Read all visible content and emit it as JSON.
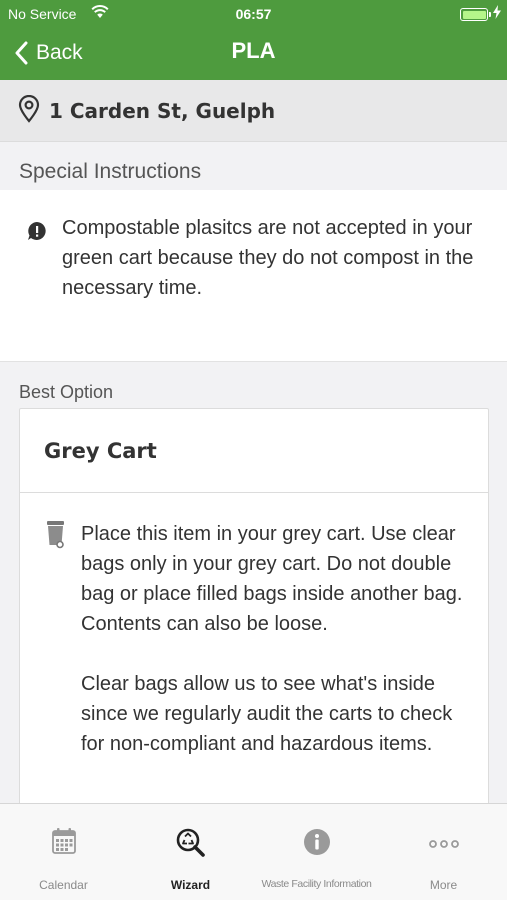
{
  "status_bar": {
    "carrier": "No Service",
    "time": "06:57"
  },
  "nav": {
    "back_label": "Back",
    "title": "PLA"
  },
  "address": {
    "text": "1 Carden St, Guelph"
  },
  "special_instructions": {
    "label": "Special Instructions",
    "text": "Compostable plasitcs are not accepted in your green cart because they do not compost in the necessary time."
  },
  "best_option": {
    "label": "Best Option",
    "card_title": "Grey Cart",
    "paragraph_1": "Place this item in your grey cart. Use clear bags only in your grey cart. Do not double bag or place filled bags inside another bag. Contents can also be loose.",
    "paragraph_2": "Clear bags allow us to see what's inside since we regularly audit the carts to check for non-compliant and hazardous items."
  },
  "tabs": [
    {
      "label": "Calendar",
      "icon": "calendar-icon"
    },
    {
      "label": "Wizard",
      "icon": "wizard-icon"
    },
    {
      "label": "Waste Facility Information",
      "icon": "info-icon"
    },
    {
      "label": "More",
      "icon": "more-icon"
    }
  ],
  "colors": {
    "header_green": "#4e9b3e",
    "tab_active": "#222222",
    "tab_inactive": "#8a8a8a"
  }
}
